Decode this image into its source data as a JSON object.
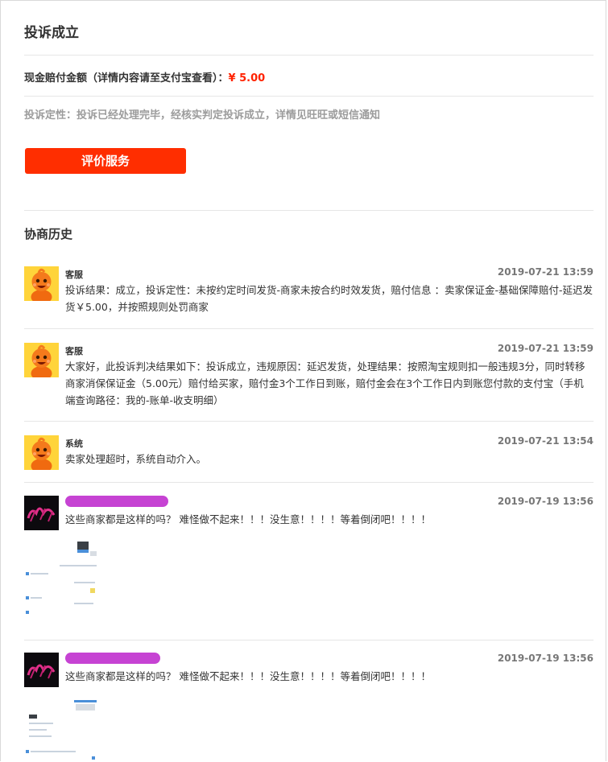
{
  "header": {
    "title": "投诉成立"
  },
  "compensation": {
    "label": "现金赔付金额（详情内容请至支付宝查看）：",
    "amount": "¥ 5.00"
  },
  "verdict": {
    "text": "投诉定性：投诉已经处理完毕，经核实判定投诉成立，详情见旺旺或短信通知"
  },
  "actions": {
    "rate_label": "评价服务"
  },
  "history": {
    "title": "协商历史",
    "messages": [
      {
        "sender": "客服",
        "time": "2019-07-21 13:59",
        "content": "投诉结果：成立，投诉定性：未按约定时间发货-商家未按合约时效发货，赔付信息 ：卖家保证金-基础保障赔付-延迟发货￥5.00，并按照规则处罚商家"
      },
      {
        "sender": "客服",
        "time": "2019-07-21 13:59",
        "content": "大家好，此投诉判决结果如下：投诉成立，违规原因：延迟发货，处理结果：按照淘宝规则扣一般违规3分，同时转移商家消保保证金（5.00元）赔付给买家，赔付金3个工作日到账，赔付金会在3个工作日内到账您付款的支付宝（手机端查询路径：我的-账单-收支明细）"
      },
      {
        "sender": "系统",
        "time": "2019-07-21 13:54",
        "content": "卖家处理超时，系统自动介入。"
      },
      {
        "sender": "",
        "time": "2019-07-19 13:56",
        "content": "这些商家都是这样的吗？ 难怪做不起来！！！没生意！！！！等着倒闭吧！！！！"
      },
      {
        "sender": "",
        "time": "2019-07-19 13:56",
        "content": "这些商家都是这样的吗？ 难怪做不起来！！！没生意！！！！等着倒闭吧！！！！"
      }
    ]
  },
  "colors": {
    "accent": "#ff2e00",
    "amount": "#ff2200",
    "muted": "#9c9c9c",
    "redaction": "#c643d3",
    "service_avatar": "#ffd43a"
  },
  "icons": {
    "service_avatar": "orange-mascot-icon",
    "user_avatar": "user-avatar-icon"
  }
}
